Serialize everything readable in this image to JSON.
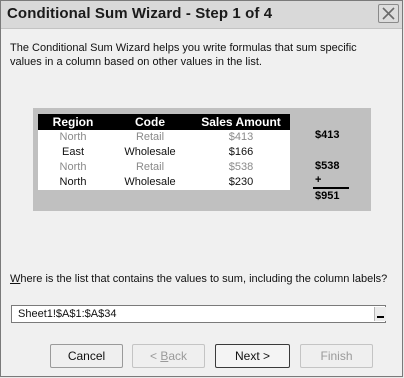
{
  "window": {
    "title": "Conditional Sum Wizard - Step 1 of 4"
  },
  "description": "The Conditional Sum Wizard helps you write formulas that sum specific values in a column based on other values in the list.",
  "example": {
    "headers": [
      "Region",
      "Code",
      "Sales Amount"
    ],
    "rows": [
      [
        "North",
        "Retail",
        "$413"
      ],
      [
        "East",
        "Wholesale",
        "$166"
      ],
      [
        "North",
        "Retail",
        "$538"
      ],
      [
        "North",
        "Wholesale",
        "$230"
      ]
    ],
    "sums": [
      "$413",
      "$538"
    ],
    "plus": "+",
    "total": "$951"
  },
  "question": {
    "accel": "W",
    "rest": "here is the list that contains the values to sum, including the column labels?"
  },
  "range_input": {
    "value": "Sheet1!$A$1:$A$34"
  },
  "buttons": {
    "cancel": "Cancel",
    "back_accel": "B",
    "back_rest": "ack",
    "back_prefix": "< ",
    "next": "Next >",
    "finish": "Finish"
  },
  "icons": {
    "close": "close-icon",
    "collapse": "collapse-dialog-icon"
  }
}
